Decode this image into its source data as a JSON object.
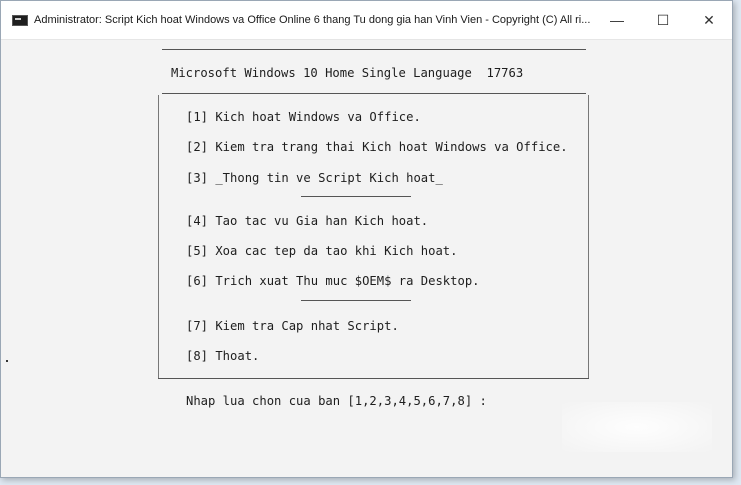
{
  "window": {
    "title": "Administrator:  Script Kich hoat Windows va Office Online 6 thang Tu dong gia han Vinh Vien - Copyright (C) All ri...",
    "minimize_glyph": "—",
    "maximize_glyph": "☐",
    "close_glyph": "✕"
  },
  "console": {
    "header": "Microsoft Windows 10 Home Single Language  17763",
    "menu": [
      "[1] Kich hoat Windows va Office.",
      "[2] Kiem tra trang thai Kich hoat Windows va Office.",
      "[3] _Thong tin ve Script Kich hoat_",
      "[4] Tao tac vu Gia han Kich hoat.",
      "[5] Xoa cac tep da tao khi Kich hoat.",
      "[6] Trich xuat Thu muc $OEM$ ra Desktop.",
      "[7] Kiem tra Cap nhat Script.",
      "[8] Thoat."
    ],
    "prompt": "Nhap lua chon cua ban [1,2,3,4,5,6,7,8] :"
  },
  "colors": {
    "console_bg": "#f3f3f3",
    "console_text": "#1e1e1e",
    "titlebar_bg": "#ffffff"
  }
}
